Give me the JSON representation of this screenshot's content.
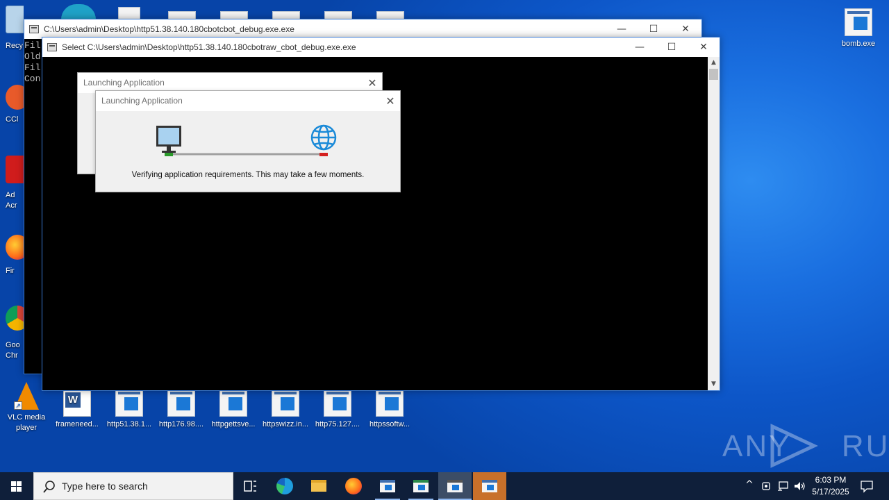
{
  "desktop": {
    "left_icons": [
      {
        "label": "Recy"
      },
      {
        "label": "CCl"
      },
      {
        "label": "Ad\nAcr"
      },
      {
        "label": "Fir"
      },
      {
        "label": "Goo\nChr"
      }
    ],
    "right_icon": {
      "label": "bomb.exe"
    },
    "bottom_icons": [
      {
        "label": "VLC media\nplayer"
      },
      {
        "label": "frameneed..."
      },
      {
        "label": "http51.38.1..."
      },
      {
        "label": "http176.98...."
      },
      {
        "label": "httpgettsve..."
      },
      {
        "label": "httpswizz.in..."
      },
      {
        "label": "http75.127...."
      },
      {
        "label": "httpssoftw..."
      }
    ],
    "watermark": "ANY RUN"
  },
  "window_back": {
    "title": "C:\\Users\\admin\\Desktop\\http51.38.140.180cbotcbot_debug.exe.exe",
    "console_lines": [
      "Fil",
      "Old",
      "Fil",
      "Con"
    ]
  },
  "window_front": {
    "title": "Select C:\\Users\\admin\\Desktop\\http51.38.140.180cbotraw_cbot_debug.exe.exe",
    "minimize": "—",
    "maximize": "☐",
    "close": "✕"
  },
  "dialog_back": {
    "title": "Launching Application"
  },
  "dialog_front": {
    "title": "Launching Application",
    "message": "Verifying application requirements. This may take a few moments."
  },
  "taskbar": {
    "search_placeholder": "Type here to search",
    "time": "6:03 PM",
    "date": "5/17/2025"
  },
  "colors": {
    "taskbar": "#0f1f3a",
    "link_green": "#2a9a2a",
    "link_red": "#d42020",
    "globe": "#1a8ad8"
  }
}
